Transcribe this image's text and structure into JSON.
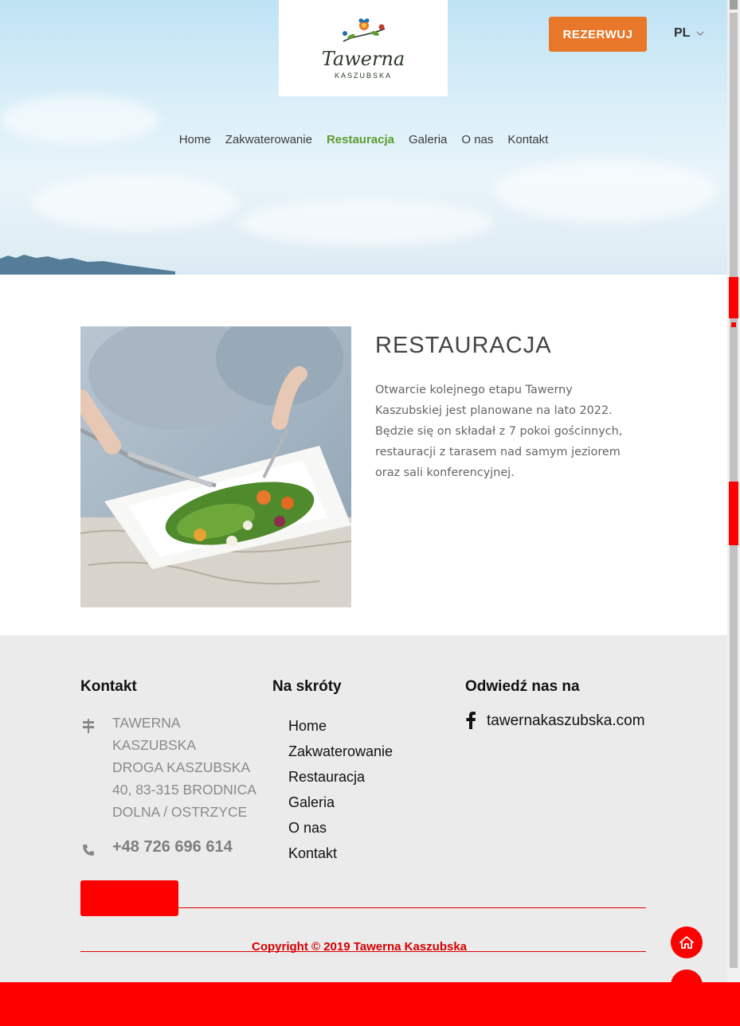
{
  "header": {
    "logo_name": "Tawerna",
    "logo_sub": "KASZUBSKA",
    "reserve_label": "REZERWUJ",
    "language": "PL"
  },
  "nav": {
    "items": [
      {
        "label": "Home",
        "active": false
      },
      {
        "label": "Zakwaterowanie",
        "active": false
      },
      {
        "label": "Restauracja",
        "active": true
      },
      {
        "label": "Galeria",
        "active": false
      },
      {
        "label": "O nas",
        "active": false
      },
      {
        "label": "Kontakt",
        "active": false
      }
    ]
  },
  "main": {
    "title": "RESTAURACJA",
    "text": "Otwarcie kolejnego etapu Tawerny Kaszubskiej jest planowane na lato 2022. Będzie się on składał z 7 pokoi gościnnych, restauracji z tarasem nad samym jeziorem oraz sali konferencyjnej."
  },
  "footer": {
    "contact_heading": "Kontakt",
    "address_lines": [
      "Tawerna",
      "Kaszubska",
      "Droga Kaszubska",
      "40, 83-315 Brodnica",
      "Dolna / Ostrzyce"
    ],
    "phone": "+48 726 696 614",
    "shortcuts_heading": "Na skróty",
    "shortcuts": [
      "Home",
      "Zakwaterowanie",
      "Restauracja",
      "Galeria",
      "O nas",
      "Kontakt"
    ],
    "visit_heading": "Odwiedź nas na",
    "facebook_link": "tawernakaszubska.com",
    "copyright": "Copyright © 2019 Tawerna Kaszubska"
  },
  "colors": {
    "accent_orange": "#e87729",
    "nav_active_green": "#5c9c2f",
    "highlight_red": "#ff0000"
  }
}
